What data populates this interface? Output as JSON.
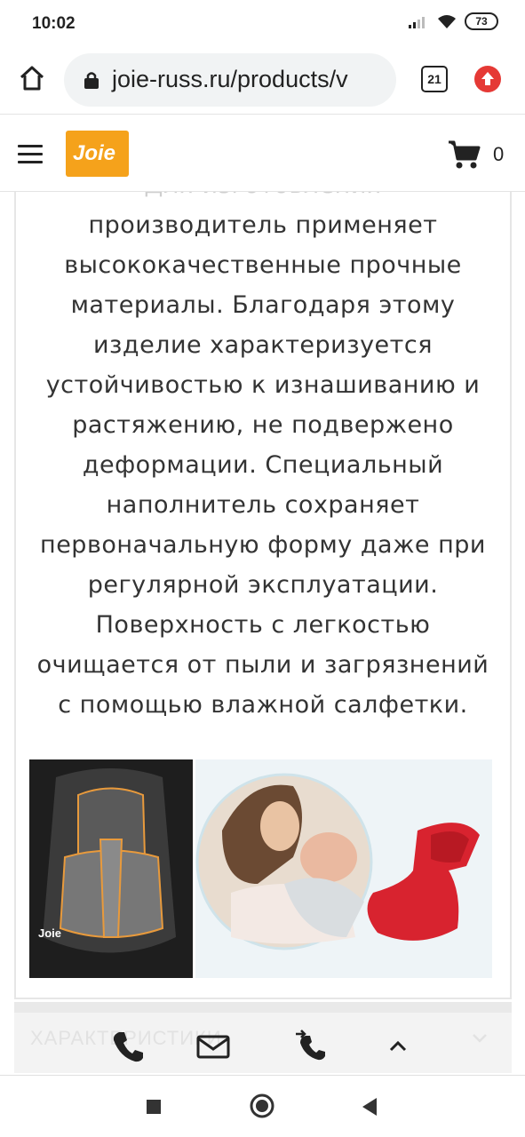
{
  "status_bar": {
    "time": "10:02",
    "battery": "73"
  },
  "browser": {
    "url": "joie-russ.ru/products/v",
    "tab_count": "21"
  },
  "site_header": {
    "logo_text": "Joie",
    "cart_count": "0"
  },
  "description": {
    "faded_line": "Для изготовления",
    "lines": [
      "производитель применяет",
      "высококачественные прочные",
      "материалы. Благодаря этому",
      "изделие характеризуется",
      "устойчивостью к изнашиванию и",
      "растяжению, не подвержено",
      "деформации. Специальный",
      "наполнитель сохраняет",
      "первоначальную форму даже при",
      "регулярной эксплуатации.",
      "Поверхность с легкостью",
      "очищается от пыли и загрязнений",
      "с помощью влажной салфетки."
    ]
  },
  "images": {
    "seat_logo": "Joie"
  },
  "characteristics": {
    "title": "ХАРАКТЕРИСТИКИ"
  },
  "colors": {
    "brand": "#f5a21b",
    "update_badge": "#e53935",
    "seat_red": "#d8232f"
  },
  "icons": {
    "home": "home-icon",
    "lock": "lock-icon",
    "tabs": "tabs-icon",
    "update": "update-icon",
    "menu": "menu-icon",
    "cart": "cart-icon",
    "phone": "phone-icon",
    "mail": "mail-icon",
    "callback": "callback-icon",
    "scroll_up": "chevron-up-icon"
  }
}
